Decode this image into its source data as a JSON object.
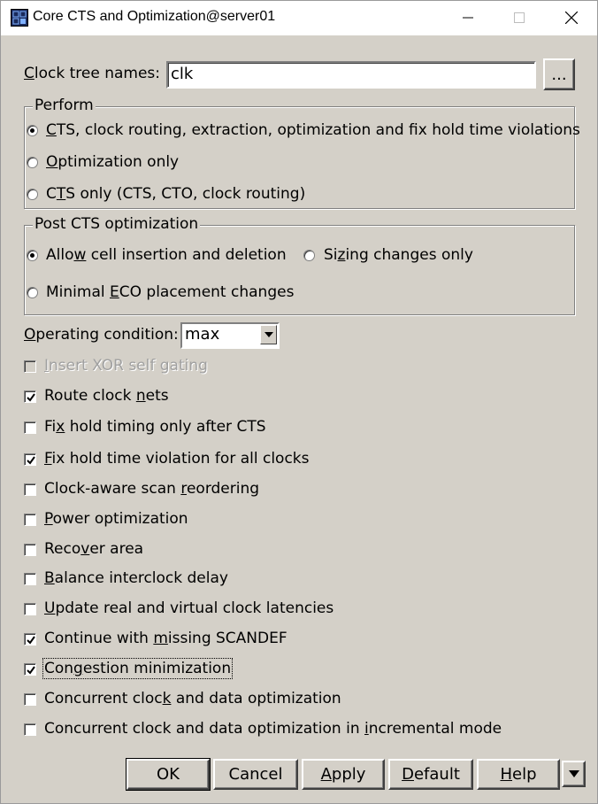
{
  "window": {
    "title": "Core CTS and Optimization@server01",
    "icon": "app-grid-icon",
    "controls": [
      "minimize-icon",
      "maximize-icon",
      "close-icon"
    ]
  },
  "clock_tree": {
    "label_pre": "",
    "label_u": "C",
    "label_post": "lock tree names:",
    "value": "clk",
    "browse_label": "..."
  },
  "perform": {
    "legend": "Perform",
    "options": [
      {
        "pre": "",
        "u": "C",
        "post": "TS, clock routing, extraction, optimization and fix hold time violations",
        "selected": true
      },
      {
        "pre": "",
        "u": "O",
        "post": "ptimization only",
        "selected": false
      },
      {
        "pre": "C",
        "u": "T",
        "post": "S only (CTS, CTO, clock routing)",
        "selected": false
      }
    ]
  },
  "post_cts": {
    "legend": "Post CTS optimization",
    "options": [
      {
        "pre": "Allo",
        "u": "w",
        "post": " cell insertion and deletion",
        "selected": true
      },
      {
        "pre": "Si",
        "u": "z",
        "post": "ing changes only",
        "selected": false
      },
      {
        "pre": "Minimal ",
        "u": "E",
        "post": "CO placement changes",
        "selected": false
      }
    ]
  },
  "operating_condition": {
    "label_pre": "",
    "label_u": "O",
    "label_post": "perating condition:",
    "value": "max"
  },
  "checkboxes": [
    {
      "pre": "",
      "u": "I",
      "post": "nsert XOR self gating",
      "checked": false,
      "disabled": true
    },
    {
      "pre": "Route clock ",
      "u": "n",
      "post": "ets",
      "checked": true,
      "disabled": false
    },
    {
      "pre": "Fi",
      "u": "x",
      "post": " hold timing only after CTS",
      "checked": false,
      "disabled": false
    },
    {
      "pre": "",
      "u": "F",
      "post": "ix hold time violation for all clocks",
      "checked": true,
      "disabled": false
    },
    {
      "pre": "Clock-aware scan ",
      "u": "r",
      "post": "eordering",
      "checked": false,
      "disabled": false
    },
    {
      "pre": "",
      "u": "P",
      "post": "ower optimization",
      "checked": false,
      "disabled": false
    },
    {
      "pre": "Reco",
      "u": "v",
      "post": "er area",
      "checked": false,
      "disabled": false
    },
    {
      "pre": "",
      "u": "B",
      "post": "alance interclock delay",
      "checked": false,
      "disabled": false
    },
    {
      "pre": "",
      "u": "U",
      "post": "pdate real and virtual clock latencies",
      "checked": false,
      "disabled": false
    },
    {
      "pre": "Continue with ",
      "u": "m",
      "post": "issing SCANDEF",
      "checked": true,
      "disabled": false
    },
    {
      "pre": "Con",
      "u": "g",
      "post": "estion minimization",
      "checked": true,
      "disabled": false,
      "focused": true
    },
    {
      "pre": "Concurrent cloc",
      "u": "k",
      "post": " and data optimization",
      "checked": false,
      "disabled": false
    },
    {
      "pre": "Concurrent clock and data optimization in ",
      "u": "i",
      "post": "ncremental mode",
      "checked": false,
      "disabled": false
    }
  ],
  "buttons": [
    {
      "name": "ok-button",
      "pre": "OK",
      "u": "",
      "post": ""
    },
    {
      "name": "cancel-button",
      "pre": "Cancel",
      "u": "",
      "post": ""
    },
    {
      "name": "apply-button",
      "pre": "",
      "u": "A",
      "post": "pply"
    },
    {
      "name": "default-button",
      "pre": "",
      "u": "D",
      "post": "efault"
    },
    {
      "name": "help-button",
      "pre": "",
      "u": "H",
      "post": "elp"
    }
  ],
  "colors": {
    "face": "#d4d0c8",
    "shadow": "#808080",
    "highlight": "#ffffff"
  }
}
